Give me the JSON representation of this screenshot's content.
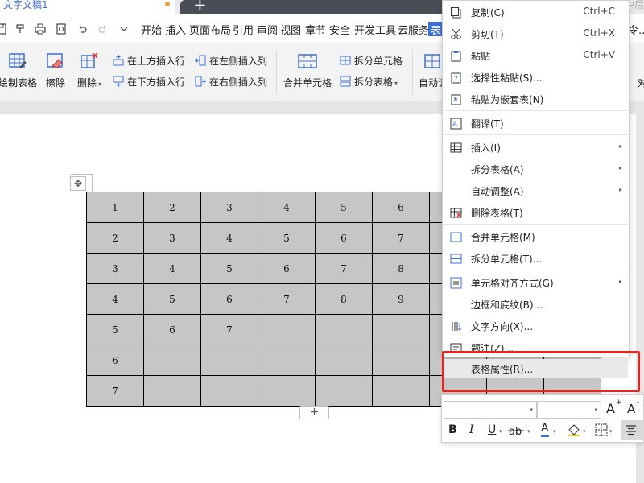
{
  "titlebar": {
    "doc_title": "文字文稿1",
    "new_tab_symbol": "+",
    "right_text": "中后"
  },
  "menubar": {
    "items": [
      "开始",
      "插入",
      "页面布局",
      "引用",
      "审阅",
      "视图",
      "章节",
      "安全",
      "开发工具",
      "云服务"
    ],
    "active_item": "表格工具",
    "more_text": "令..."
  },
  "ribbon": {
    "draw_table": "绘制表格",
    "erase": "擦除",
    "delete": "删除",
    "insert_above": "在上方插入行",
    "insert_below": "在下方插入行",
    "insert_left": "在左侧插入列",
    "insert_right": "在右侧插入列",
    "merge_cells": "合并单元格",
    "split_cells": "拆分单元格",
    "split_table": "拆分表格",
    "auto_fit": "自动调",
    "right_cut": "对"
  },
  "table": {
    "move_symbol": "✥",
    "add_row_symbol": "+",
    "rows": [
      [
        "1",
        "2",
        "3",
        "4",
        "5",
        "6",
        "",
        "",
        ""
      ],
      [
        "2",
        "3",
        "4",
        "5",
        "6",
        "7",
        "",
        "",
        ""
      ],
      [
        "3",
        "4",
        "5",
        "6",
        "7",
        "8",
        "",
        "",
        ""
      ],
      [
        "4",
        "5",
        "6",
        "7",
        "8",
        "9",
        "",
        "",
        ""
      ],
      [
        "5",
        "6",
        "7",
        "",
        "",
        "",
        "",
        "",
        ""
      ],
      [
        "6",
        "",
        "",
        "",
        "",
        "",
        "",
        "",
        ""
      ],
      [
        "7",
        "",
        "",
        "",
        "",
        "",
        "",
        "",
        ""
      ]
    ]
  },
  "context_menu": {
    "copy": "复制(C)",
    "copy_shortcut": "Ctrl+C",
    "cut": "剪切(T)",
    "cut_shortcut": "Ctrl+X",
    "paste": "粘贴",
    "paste_shortcut": "Ctrl+V",
    "paste_special": "选择性粘贴(S)...",
    "paste_nested": "粘贴为嵌套表(N)",
    "translate": "翻译(T)",
    "insert": "插入(I)",
    "split_table": "拆分表格(A)",
    "auto_fit": "自动调整(A)",
    "delete_table": "删除表格(T)",
    "merge_cells": "合并单元格(M)",
    "split_cells": "拆分单元格(T)...",
    "cell_align": "单元格对齐方式(G)",
    "borders": "边框和底纹(B)...",
    "text_direction": "文字方向(X)...",
    "caption": "题注(Z)...",
    "table_properties": "表格属性(R)..."
  },
  "mini_toolbar": {
    "grow_font": "A",
    "shrink_font": "A",
    "bold": "B",
    "italic": "I",
    "underline": "U",
    "font_color_letter": "A"
  },
  "colors": {
    "accent": "#3c6fd8",
    "highlight_box": "#e8241f",
    "cell_fill": "#c6c6c6"
  }
}
